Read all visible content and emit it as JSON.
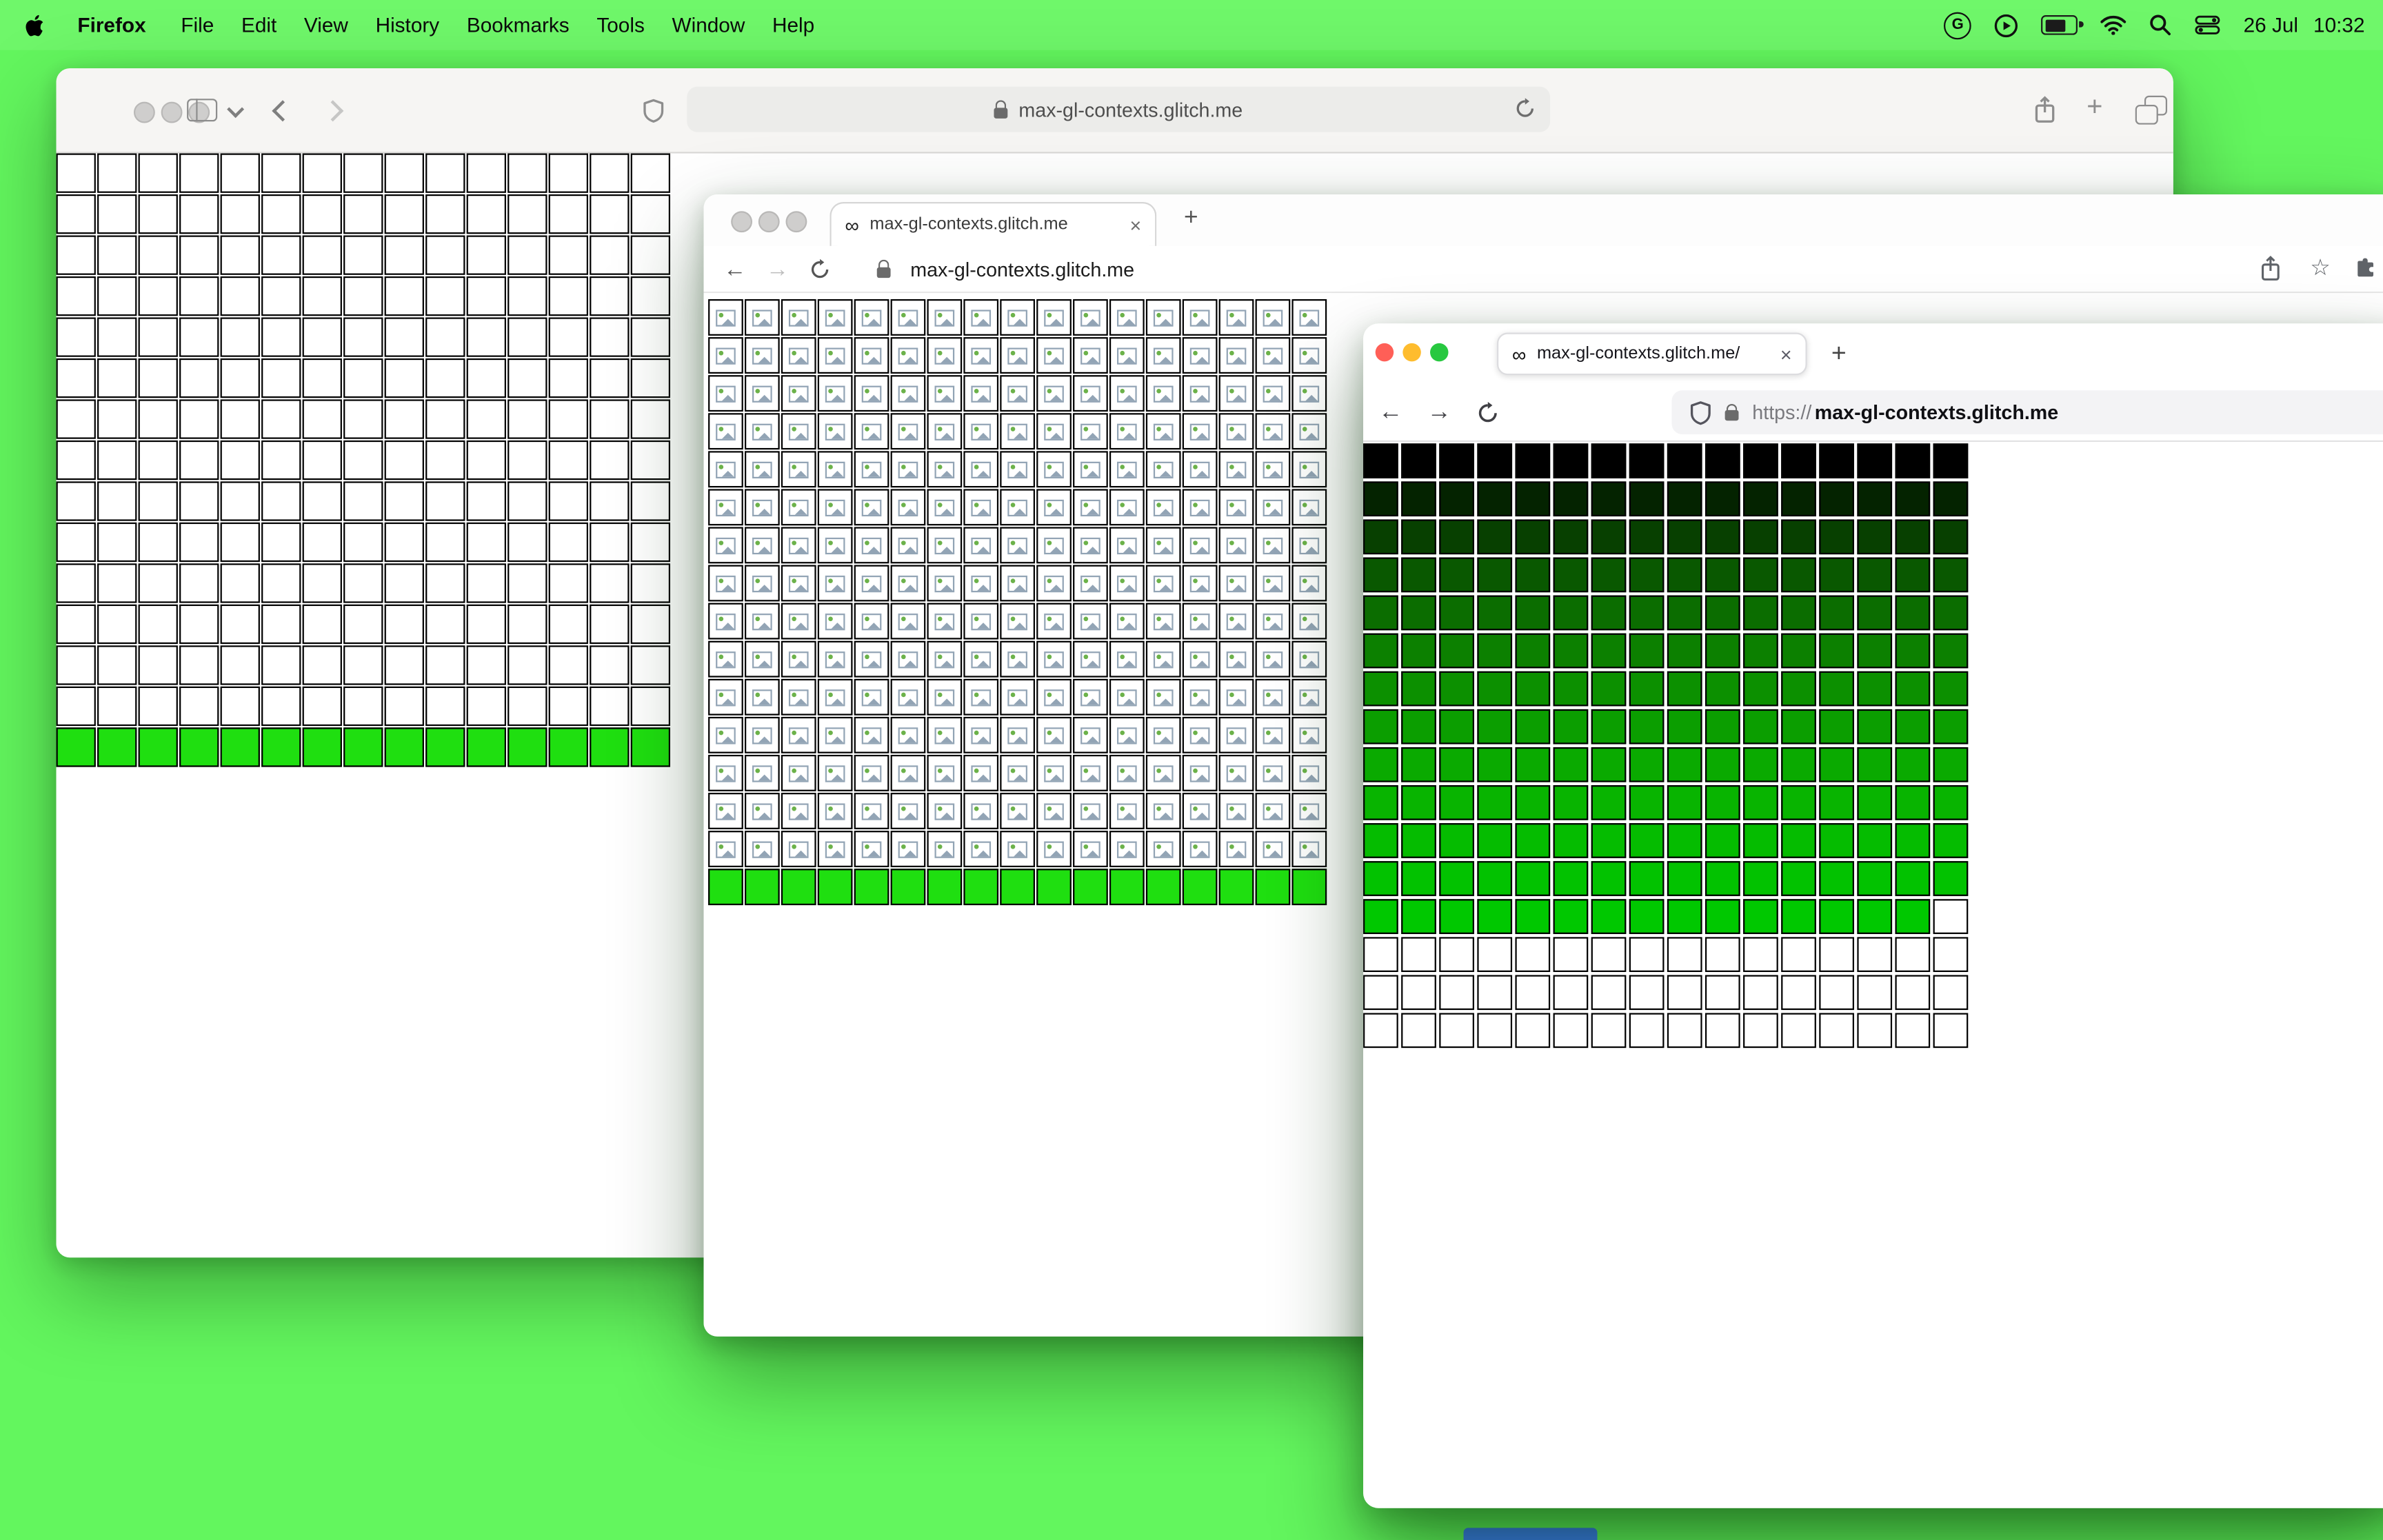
{
  "menu_bar": {
    "app_name": "Firefox",
    "menus": [
      "File",
      "Edit",
      "View",
      "History",
      "Bookmarks",
      "Tools",
      "Window",
      "Help"
    ],
    "date": "26 Jul",
    "time": "10:32"
  },
  "glyphs": {
    "infinity": "∞",
    "close": "×",
    "plus": "+",
    "star": "☆",
    "back_arrow": "←",
    "forward_arrow": "→",
    "g_badge": "G"
  },
  "colors": {
    "desktop": "#63f65e",
    "grid_lime": "#1fdf10",
    "traffic_red": "#ff5f57",
    "traffic_yellow": "#febc2e",
    "traffic_green": "#28c840",
    "dock_hint_blue": "#3e7bf7"
  },
  "safari_window": {
    "url": "max-gl-contexts.glitch.me",
    "grid": {
      "cols": 15,
      "rows": [
        {
          "color": "#ffffff",
          "repeat": 14
        },
        {
          "color": "#1fdf10"
        }
      ]
    }
  },
  "chrome_window": {
    "tab_title": "max-gl-contexts.glitch.me",
    "url": "max-gl-contexts.glitch.me",
    "grid": {
      "cols": 17,
      "rows": [
        {
          "color": "#ffffff",
          "icon": true,
          "repeat": 15
        },
        {
          "color": "#1fdf10"
        }
      ]
    }
  },
  "firefox_window": {
    "tab_title": "max-gl-contexts.glitch.me/",
    "url_scheme": "https://",
    "url_host": "max-gl-contexts.glitch.me",
    "grid": {
      "cols": 16,
      "rows": [
        {
          "color": "#000000"
        },
        {
          "color": "#042300"
        },
        {
          "color": "#074000"
        },
        {
          "color": "#095800"
        },
        {
          "color": "#0b6d00"
        },
        {
          "color": "#0c8000"
        },
        {
          "color": "#0c9000"
        },
        {
          "color": "#0b9e00"
        },
        {
          "color": "#0aaa00"
        },
        {
          "color": "#08b400"
        },
        {
          "color": "#05bc00"
        },
        {
          "color": "#02c200"
        },
        {
          "color": "#00c800",
          "last_cell": "#ffffff"
        },
        {
          "color": "#ffffff",
          "repeat": 3
        }
      ]
    }
  }
}
